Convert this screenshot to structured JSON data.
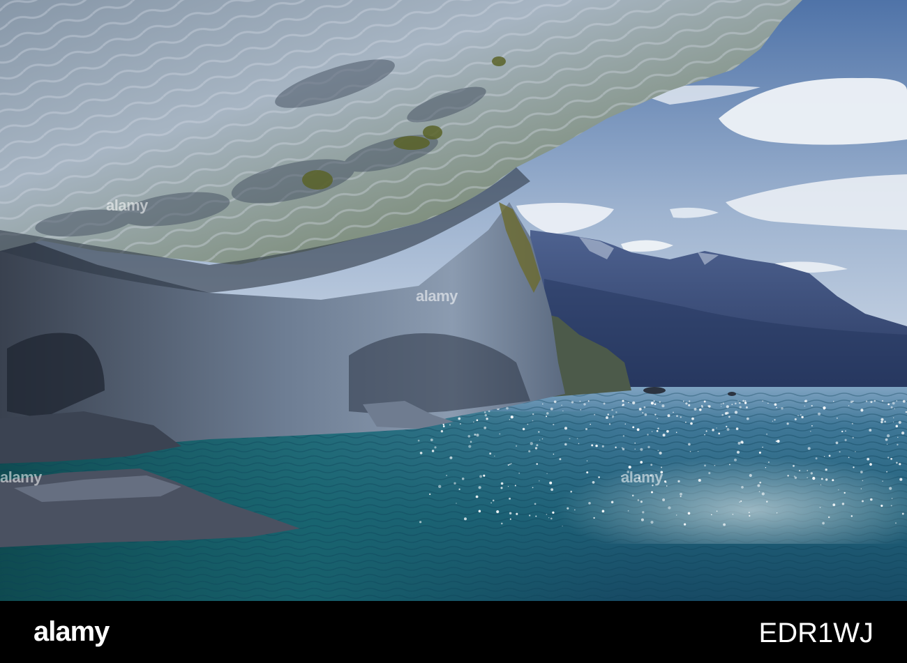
{
  "photo": {
    "subject": "marble-cave-over-lake",
    "colors": {
      "sky_top": "#5d7fb0",
      "sky_bottom": "#c9d6e6",
      "cloud": "#eef2f7",
      "mountain_far": "#3c4f78",
      "mountain_near": "#2a3a5e",
      "rock_light": "#a9b7c6",
      "rock_mid": "#6e7f95",
      "rock_dark": "#2d3645",
      "moss": "#6b6a2e",
      "water_teal": "#1f6f78",
      "water_deep": "#0f4450",
      "water_blue": "#2d5f84",
      "sparkle": "#ffffff"
    }
  },
  "watermark": {
    "text": "alamy"
  },
  "footer": {
    "logo": "alamy",
    "image_code": "EDR1WJ",
    "background": "#000000",
    "text_color": "#ffffff"
  }
}
